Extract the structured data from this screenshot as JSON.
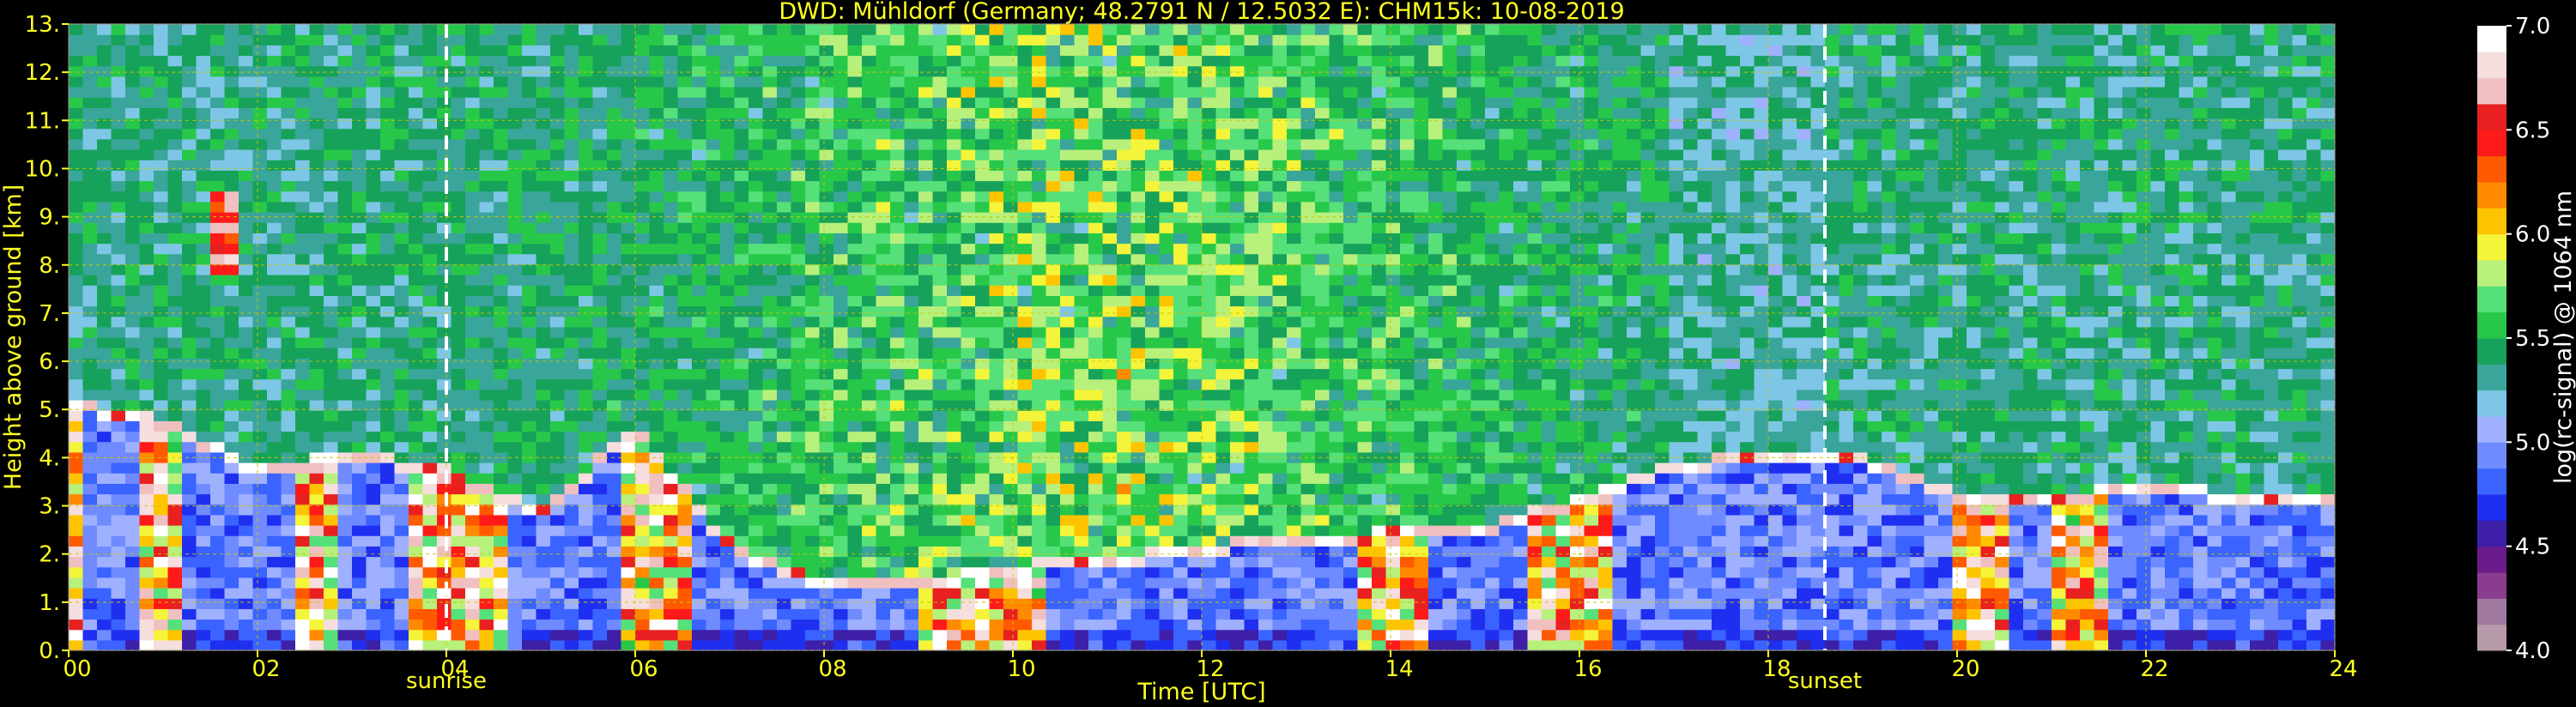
{
  "chart_data": {
    "type": "heatmap",
    "title": "DWD: Mühldorf (Germany; 48.2791 N / 12.5032 E):    CHM15k: 10-08-2019",
    "xlabel": "Time [UTC]",
    "ylabel": "Height above ground [km]",
    "colorbar_label": "log(rc-signal) @ 1064 nm",
    "x_ticks": [
      "00",
      "02",
      "04",
      "06",
      "08",
      "10",
      "12",
      "14",
      "16",
      "18",
      "20",
      "22",
      "24"
    ],
    "x_tick_values": [
      0,
      2,
      4,
      6,
      8,
      10,
      12,
      14,
      16,
      18,
      20,
      22,
      24
    ],
    "y_ticks": [
      "0.",
      "1.",
      "2.",
      "3.",
      "4.",
      "5.",
      "6.",
      "7.",
      "8.",
      "9.",
      "10.",
      "11.",
      "12.",
      "13."
    ],
    "y_tick_values": [
      0,
      1,
      2,
      3,
      4,
      5,
      6,
      7,
      8,
      9,
      10,
      11,
      12,
      13
    ],
    "xlim": [
      0,
      24
    ],
    "ylim": [
      0,
      13
    ],
    "colorbar_ticks": [
      "4.0",
      "4.5",
      "5.0",
      "5.5",
      "6.0",
      "6.5",
      "7.0"
    ],
    "colorbar_tick_values": [
      4.0,
      4.5,
      5.0,
      5.5,
      6.0,
      6.5,
      7.0
    ],
    "colorbar_range": [
      4.0,
      7.0
    ],
    "grid": true,
    "annotations": [
      {
        "label": "sunrise",
        "time": 4.0
      },
      {
        "label": "sunset",
        "time": 18.6
      }
    ],
    "colors": {
      "text": "#ffff22",
      "grid": "#c8c800",
      "marker_line": "#ffffff",
      "colormap": [
        "#b79aa9",
        "#a07aa0",
        "#8a3d8e",
        "#6a1b8a",
        "#3e1fa8",
        "#1f2ff0",
        "#3a63ff",
        "#6f8bff",
        "#9fb0ff",
        "#7ec6e6",
        "#3aa59a",
        "#16a25a",
        "#27c84a",
        "#55e07a",
        "#b8f07c",
        "#f4f43a",
        "#ffc400",
        "#ff8a00",
        "#ff5a00",
        "#ff1a1a",
        "#e82020",
        "#f0c0c0",
        "#f6dede",
        "#ffffff"
      ]
    },
    "data_summary": {
      "background_above_layer": "noisy 5.0-6.0 log-signal (green/blue), higher noise midday",
      "boundary_layer_top_km": [
        {
          "t": 0.0,
          "h": 5.0
        },
        {
          "t": 1.0,
          "h": 4.6
        },
        {
          "t": 2.0,
          "h": 3.6
        },
        {
          "t": 3.0,
          "h": 4.0
        },
        {
          "t": 4.0,
          "h": 3.6
        },
        {
          "t": 5.0,
          "h": 2.7
        },
        {
          "t": 6.0,
          "h": 4.5
        },
        {
          "t": 7.0,
          "h": 2.0
        },
        {
          "t": 8.0,
          "h": 1.3
        },
        {
          "t": 9.0,
          "h": 1.2
        },
        {
          "t": 10.0,
          "h": 1.6
        },
        {
          "t": 11.0,
          "h": 1.7
        },
        {
          "t": 12.0,
          "h": 2.0
        },
        {
          "t": 13.0,
          "h": 2.2
        },
        {
          "t": 14.0,
          "h": 2.3
        },
        {
          "t": 15.0,
          "h": 2.4
        },
        {
          "t": 16.0,
          "h": 3.0
        },
        {
          "t": 17.0,
          "h": 3.7
        },
        {
          "t": 18.0,
          "h": 3.9
        },
        {
          "t": 19.0,
          "h": 3.8
        },
        {
          "t": 20.0,
          "h": 3.1
        },
        {
          "t": 21.0,
          "h": 3.1
        },
        {
          "t": 22.0,
          "h": 3.2
        },
        {
          "t": 23.0,
          "h": 3.1
        },
        {
          "t": 24.0,
          "h": 3.0
        }
      ],
      "strong_cloud_columns_utc": [
        [
          0.0,
          0.2
        ],
        [
          0.7,
          1.2
        ],
        [
          2.4,
          2.9
        ],
        [
          3.6,
          4.6
        ],
        [
          5.8,
          6.6
        ],
        [
          9.0,
          10.4
        ],
        [
          13.6,
          14.4
        ],
        [
          15.4,
          16.4
        ],
        [
          20.0,
          20.6
        ],
        [
          21.0,
          21.6
        ]
      ],
      "high_cloud_patches": [
        {
          "t": [
            1.5,
            1.8
          ],
          "h": [
            7.8,
            9.6
          ]
        }
      ]
    }
  }
}
